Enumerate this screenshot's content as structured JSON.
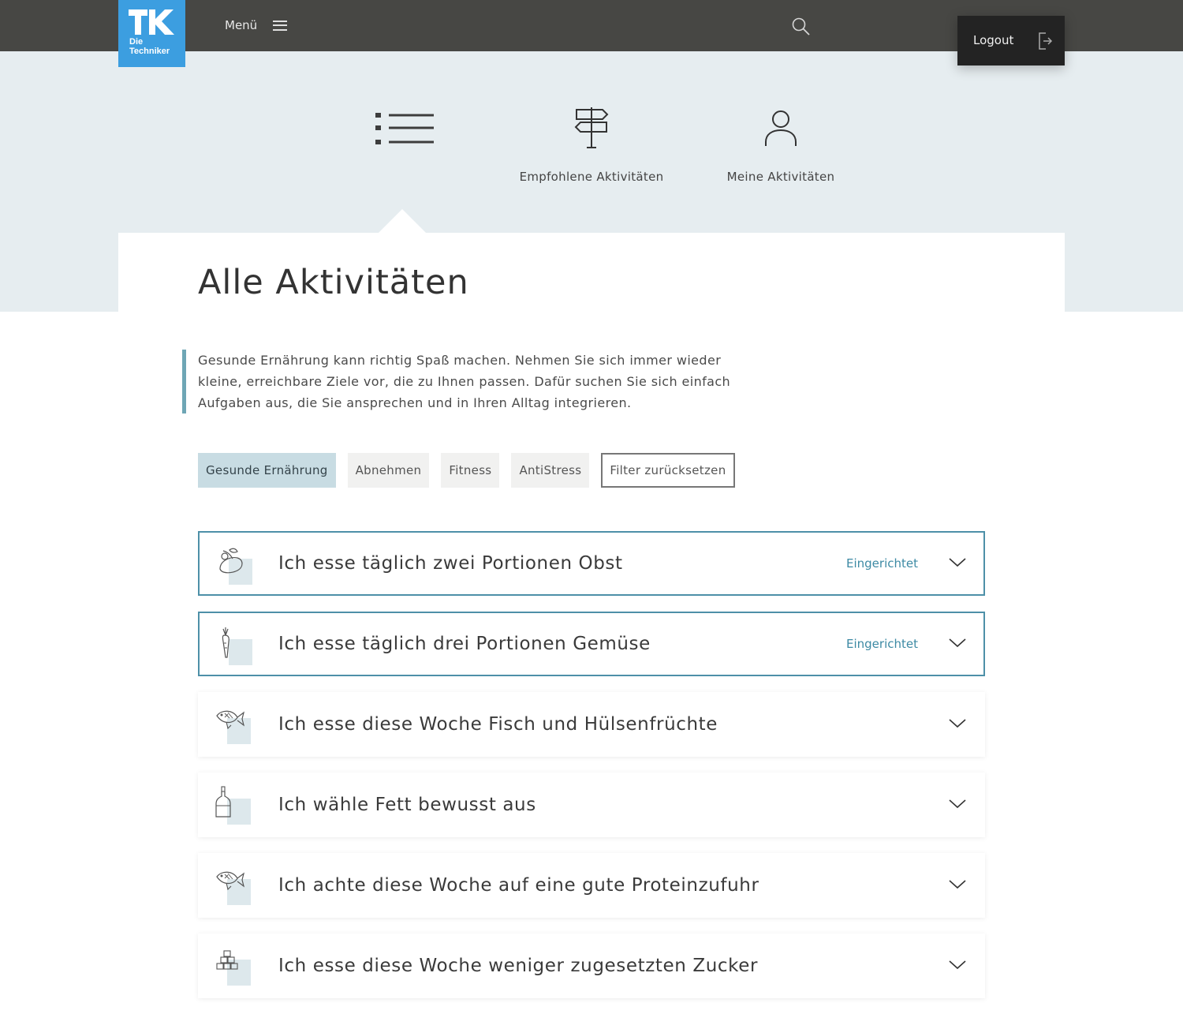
{
  "header": {
    "logo_text_line1": "Die",
    "logo_text_line2": "Techniker",
    "menu_label": "Menü",
    "logout_label": "Logout"
  },
  "nav": {
    "tiles": [
      {
        "label": "",
        "icon": "list-icon",
        "active": true
      },
      {
        "label": "Empfohlene Aktivitäten",
        "icon": "signpost-icon",
        "active": false
      },
      {
        "label": "Meine Aktivitäten",
        "icon": "person-icon",
        "active": false
      }
    ]
  },
  "page": {
    "title": "Alle Aktivitäten",
    "intro": "Gesunde Ernährung kann richtig Spaß machen. Nehmen Sie sich immer wieder kleine, erreichbare Ziele vor, die zu Ihnen passen. Dafür suchen Sie sich einfach Aufgaben aus, die Sie ansprechen und in Ihren Alltag integrieren."
  },
  "filters": [
    {
      "label": "Gesunde Ernährung",
      "active": true
    },
    {
      "label": "Abnehmen",
      "active": false
    },
    {
      "label": "Fitness",
      "active": false
    },
    {
      "label": "AntiStress",
      "active": false
    }
  ],
  "filter_reset_label": "Filter zurücksetzen",
  "activities": [
    {
      "title": "Ich esse täglich zwei Portionen Obst",
      "status": "Eingerichtet",
      "icon": "fruit-icon"
    },
    {
      "title": "Ich esse täglich drei Portionen Gemüse",
      "status": "Eingerichtet",
      "icon": "carrot-icon"
    },
    {
      "title": "Ich esse diese Woche Fisch und Hülsenfrüchte",
      "status": "",
      "icon": "fish-icon"
    },
    {
      "title": "Ich wähle Fett bewusst aus",
      "status": "",
      "icon": "oil-bottle-icon"
    },
    {
      "title": "Ich achte diese Woche auf eine gute Proteinzufuhr",
      "status": "",
      "icon": "fish-icon"
    },
    {
      "title": "Ich esse diese Woche weniger zugesetzten Zucker",
      "status": "",
      "icon": "sugar-cubes-icon"
    }
  ],
  "colors": {
    "topbar": "#474744",
    "logo": "#3c9ee0",
    "hero": "#e6edf0",
    "accent": "#4d90a8",
    "active_filter": "#c8dce3"
  }
}
